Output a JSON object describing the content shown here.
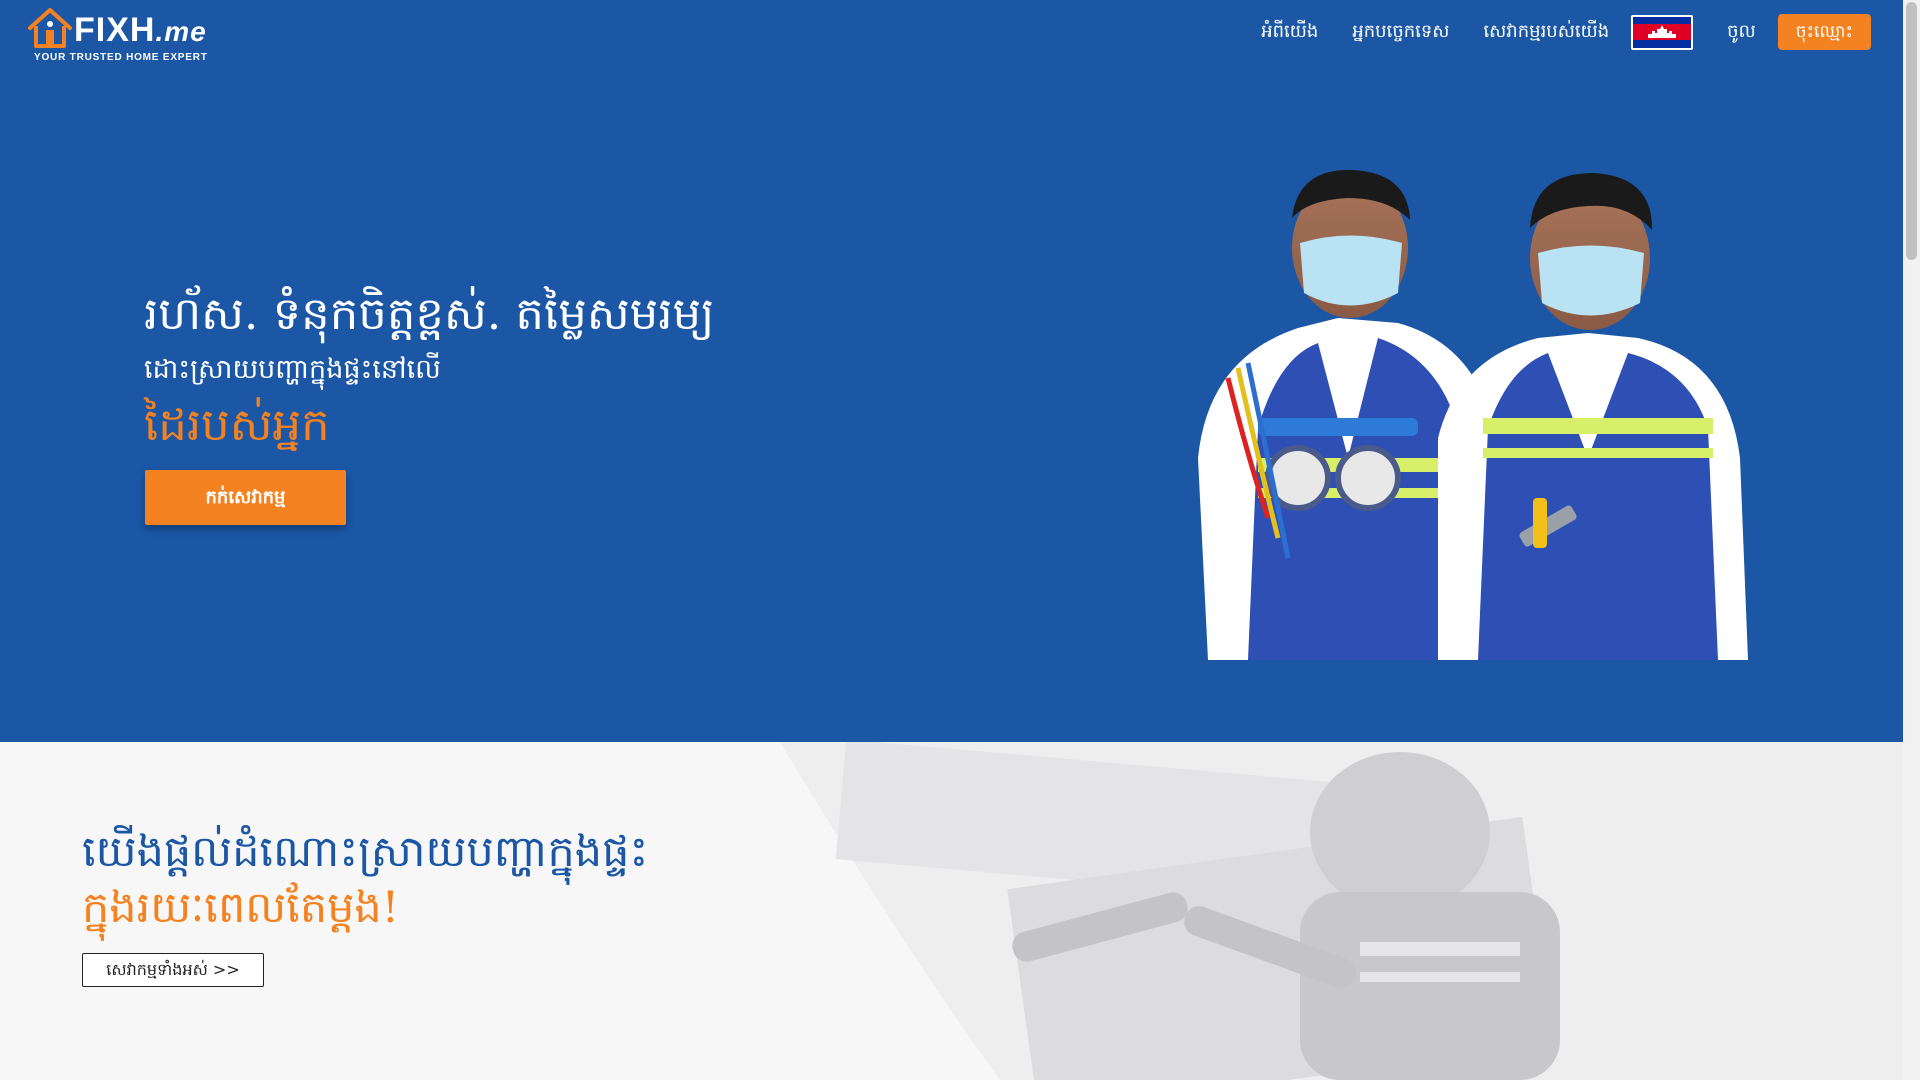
{
  "header": {
    "logo": {
      "wordmark": "FIXH",
      "wordmark_suffix": ".me",
      "tagline": "YOUR TRUSTED HOME EXPERT"
    },
    "nav": [
      {
        "label": "អំពីយើង"
      },
      {
        "label": "អ្នកបច្ចេកទេស"
      },
      {
        "label": "សេវាកម្មរបស់យើង"
      }
    ],
    "language_flag": "cambodia-flag-icon",
    "login_label": "ចូល",
    "signup_label": "ចុះឈ្មោះ"
  },
  "hero": {
    "title": "រហ័ស. ទំនុកចិត្តខ្ពស់. តម្លៃសមរម្យ",
    "subtitle": "ដោះស្រាយបញ្ហាក្នុងផ្ទះនៅលើ",
    "accent": "ដៃរបស់អ្នក",
    "cta_label": "កក់សេវាកម្ម",
    "image": "two-technicians-in-masks-photo"
  },
  "section2": {
    "title": "យើងផ្តល់ដំណោះស្រាយបញ្ហាក្នុងផ្ទះ",
    "accent": "ក្នុងរយៈពេលតែម្តង!",
    "button_label": "សេវាកម្មទាំងអស់ >>",
    "background_image": "technician-installing-ac-photo"
  },
  "colors": {
    "primary_blue": "#1b57a5",
    "accent_orange": "#f58220",
    "section_bg": "#f7f7f8"
  }
}
